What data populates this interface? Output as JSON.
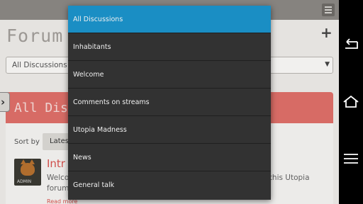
{
  "app": {
    "page_title": "Forum",
    "add_button_glyph": "+",
    "filter_select_value": "All Discussions",
    "side_tab_glyph": "›",
    "banner_title": "All Disc",
    "sort_label": "Sort by",
    "sort_value": "Lates",
    "avatar_tag": "ADMIN",
    "post": {
      "title": "Intr",
      "line1": "Welco",
      "line1_right": "e this Utopia",
      "line2": "forum",
      "read_more": "Read more"
    }
  },
  "dropdown": {
    "selected_index": 0,
    "accent_color": "#1a8ec4",
    "items": [
      "All Discussions",
      "Inhabitants",
      "Welcome",
      "Comments on streams",
      "Utopia Madness",
      "News",
      "General talk"
    ]
  },
  "navbar": {
    "icons": [
      "back-icon",
      "home-icon",
      "menu-icon"
    ]
  }
}
